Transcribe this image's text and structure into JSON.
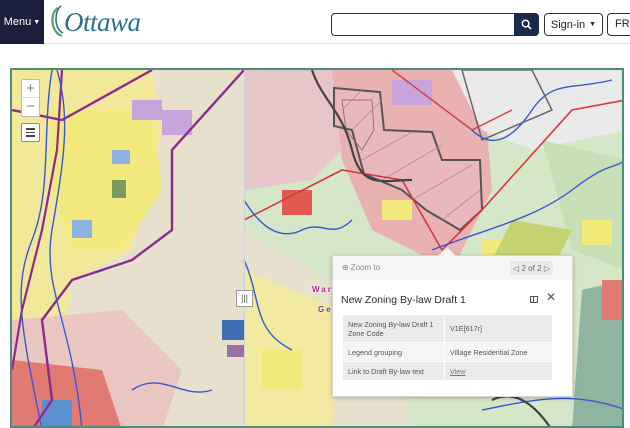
{
  "header": {
    "menu_label": "Menu",
    "logo_text": "Ottawa",
    "search": {
      "value": "",
      "placeholder": ""
    },
    "search_icon": "search-icon",
    "signin_label": "Sign-in",
    "lang_label": "FR",
    "accent_color": "#1b1f3b"
  },
  "map": {
    "controls": {
      "zoom_in": "+",
      "zoom_out": "−",
      "layers_icon": "layer-list-icon",
      "swipe_handle": "|||"
    },
    "place_label_line1": "War",
    "place_label_line2": "Ge",
    "colors": {
      "residential_yellow": "#f2ea7b",
      "commercial_blue": "#8fb2e3",
      "industrial_purple": "#c9a4dc",
      "rural_green": "#cfe4c2",
      "institutional_red": "#e07a72",
      "boundary_purple": "#8e2a8f",
      "water_blue": "#3658d6"
    }
  },
  "popup": {
    "zoom_to": "Zoom to",
    "pager": "2 of 2",
    "title": "New Zoning By-law Draft 1",
    "attributes": [
      {
        "key": "New Zoning By-law Draft 1 Zone Code",
        "value": "V1E[617r]"
      },
      {
        "key": "Legend grouping",
        "value": "Village Residential Zone"
      },
      {
        "key": "Link to Draft By-law text",
        "value": "View"
      }
    ]
  }
}
